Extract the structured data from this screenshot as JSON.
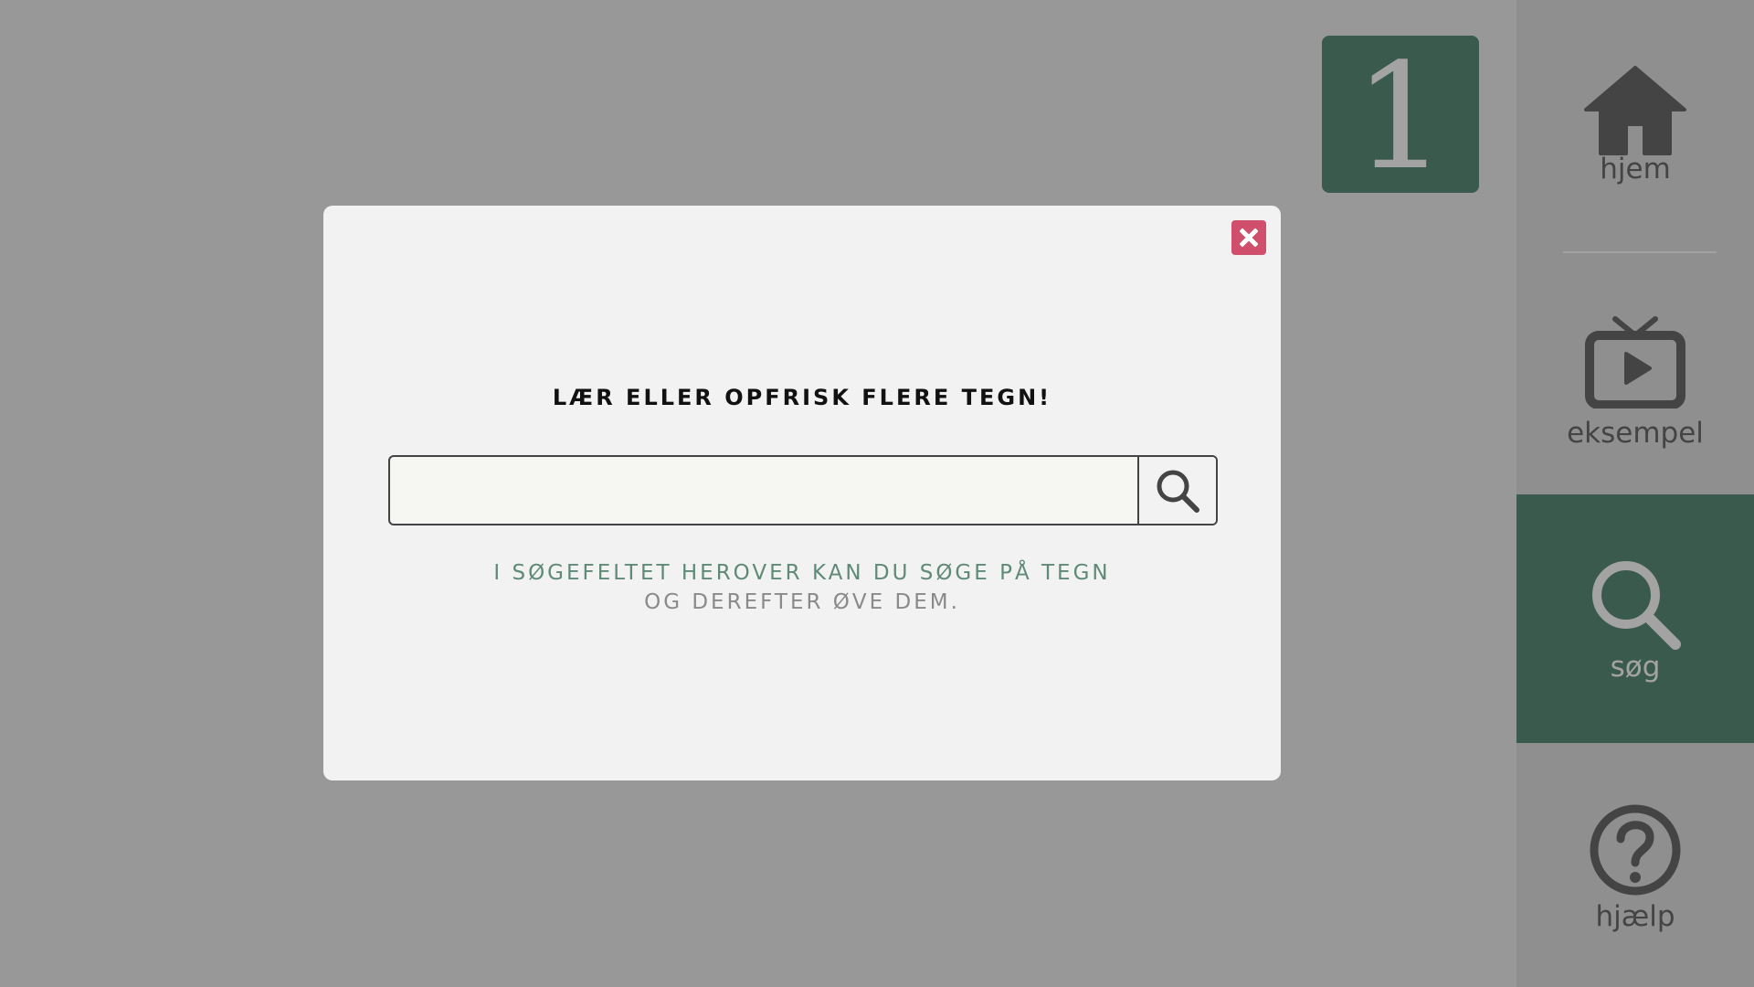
{
  "level_badge": {
    "value": "1"
  },
  "sidebar": {
    "items": [
      {
        "label": "hjem",
        "icon": "home-icon"
      },
      {
        "label": "eksempel",
        "icon": "tv-play-icon"
      },
      {
        "label": "søg",
        "icon": "search-icon",
        "active": true
      },
      {
        "label": "hjælp",
        "icon": "help-circle-icon"
      }
    ]
  },
  "modal": {
    "title": "LÆR ELLER OPFRISK FLERE TEGN!",
    "search": {
      "value": "",
      "placeholder": ""
    },
    "hint_line1": "I SØGEFELTET HEROVER KAN DU SØGE PÅ TEGN",
    "hint_line2": "OG DEREFTER ØVE DEM."
  },
  "colors": {
    "background": "#989898",
    "sidebar": "#8f8f8f",
    "accent_green": "#3a5a4d",
    "close_red": "#cf4f6c",
    "modal": "#f2f2f2"
  }
}
